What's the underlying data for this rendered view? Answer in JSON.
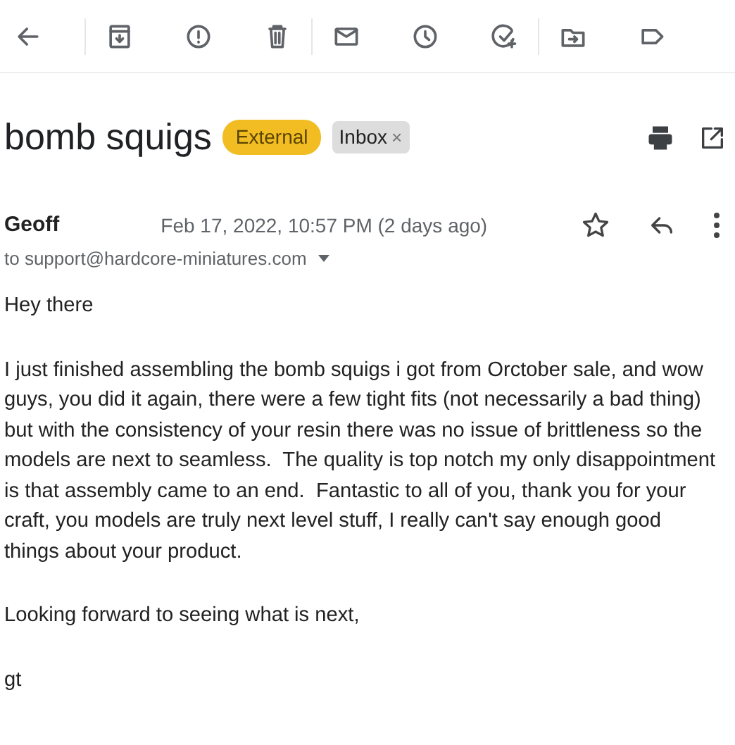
{
  "toolbar": {
    "groups": [
      [
        {
          "kind": "back"
        }
      ],
      [
        {
          "kind": "archive"
        },
        {
          "kind": "report"
        },
        {
          "kind": "delete"
        }
      ],
      [
        {
          "kind": "unread"
        },
        {
          "kind": "snooze"
        },
        {
          "kind": "task"
        }
      ],
      [
        {
          "kind": "move"
        },
        {
          "kind": "label"
        }
      ]
    ]
  },
  "subject": "bomb squigs",
  "labels": [
    {
      "text": "External",
      "color": "#f2bd23",
      "removable": false
    },
    {
      "text": "Inbox",
      "color": "#dddddd",
      "removable": true,
      "remove": "×"
    }
  ],
  "message": {
    "sender": "Geoff",
    "date": "Feb 17, 2022, 10:57 PM (2 days ago)",
    "starred": false,
    "recipient": "to support@hardcore-miniatures.com",
    "body": [
      "Hey there",
      "I just finished assembling the bomb squigs i got from Orctober sale, and wow guys, you did it again, there were a few tight fits (not necessarily a bad thing) but with the consistency of your resin there was no issue of brittleness so the models are next to seamless.  The quality is top notch my only disappointment is that assembly came to an end.  Fantastic to all of you, thank you for your craft, you models are truly next level stuff, I really can't say enough good things about your product.",
      "Looking forward to seeing what is next,",
      "gt"
    ]
  }
}
